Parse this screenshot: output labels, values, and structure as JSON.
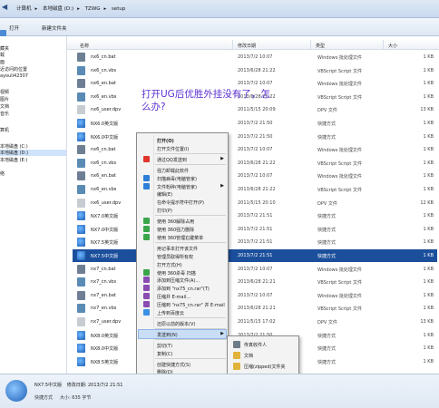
{
  "address": {
    "parts": [
      "计算机",
      "本地磁盘 (D:)",
      "TZWG",
      "setup"
    ]
  },
  "toolbar": {
    "open": "打开",
    "new_folder": "新建文件夹"
  },
  "nav": {
    "items": [
      {
        "label": "藏夹",
        "selected": false
      },
      {
        "label": "载",
        "selected": false
      },
      {
        "label": "面",
        "selected": false
      },
      {
        "label": "近访问的位置",
        "selected": false
      },
      {
        "label": "ayouli42307",
        "selected": false
      },
      {
        "label": "视频",
        "selected": false
      },
      {
        "label": "图片",
        "selected": false
      },
      {
        "label": "文档",
        "selected": false
      },
      {
        "label": "音乐",
        "selected": false
      },
      {
        "label": "算机",
        "selected": false
      },
      {
        "label": "本地磁盘 (C:)",
        "selected": false
      },
      {
        "label": "本地磁盘 (D:)",
        "selected": true
      },
      {
        "label": "本地磁盘 (E:)",
        "selected": false
      },
      {
        "label": "络",
        "selected": false
      }
    ]
  },
  "headers": {
    "name": "名称",
    "date": "修改日期",
    "type": "类型",
    "size": "大小"
  },
  "files": [
    {
      "name": "nx6_cn.bat",
      "date": "2013/7/2 10:07",
      "type": "Windows 批处理文件",
      "size": "1 KB",
      "icon": "bat",
      "selected": false
    },
    {
      "name": "nx6_cn.vbs",
      "date": "2013/6/28 21:22",
      "type": "VBScript Script 文件",
      "size": "1 KB",
      "icon": "vbs",
      "selected": false
    },
    {
      "name": "nx6_en.bat",
      "date": "2013/7/2 10:07",
      "type": "Windows 批处理文件",
      "size": "1 KB",
      "icon": "bat",
      "selected": false
    },
    {
      "name": "nx6_en.vbs",
      "date": "2013/6/28 21:22",
      "type": "VBScript Script 文件",
      "size": "1 KB",
      "icon": "vbs",
      "selected": false
    },
    {
      "name": "nx6_user.dpv",
      "date": "2011/5/15 20:09",
      "type": "DPV 文件",
      "size": "13 KB",
      "icon": "dpv",
      "selected": false
    },
    {
      "name": "NX6.0英文版",
      "date": "2013/7/2 21:50",
      "type": "快捷方式",
      "size": "1 KB",
      "icon": "lnk",
      "selected": false
    },
    {
      "name": "NX6.0中文版",
      "date": "2013/7/2 21:50",
      "type": "快捷方式",
      "size": "1 KB",
      "icon": "lnk",
      "selected": false
    },
    {
      "name": "nx6_cn.bat",
      "date": "2013/7/2 10:07",
      "type": "Windows 批处理文件",
      "size": "1 KB",
      "icon": "bat",
      "selected": false
    },
    {
      "name": "nx6_cn.vbs",
      "date": "2013/6/28 21:22",
      "type": "VBScript Script 文件",
      "size": "1 KB",
      "icon": "vbs",
      "selected": false
    },
    {
      "name": "nx6_en.bat",
      "date": "2013/7/2 10:07",
      "type": "Windows 批处理文件",
      "size": "1 KB",
      "icon": "bat",
      "selected": false
    },
    {
      "name": "nx6_en.vbs",
      "date": "2013/6/28 21:22",
      "type": "VBScript Script 文件",
      "size": "1 KB",
      "icon": "vbs",
      "selected": false
    },
    {
      "name": "nx6_user.dpv",
      "date": "2011/5/15 20:10",
      "type": "DPV 文件",
      "size": "12 KB",
      "icon": "dpv",
      "selected": false
    },
    {
      "name": "NX7.0英文版",
      "date": "2013/7/2 21:51",
      "type": "快捷方式",
      "size": "1 KB",
      "icon": "lnk",
      "selected": false
    },
    {
      "name": "NX7.0中文版",
      "date": "2013/7/2 21:51",
      "type": "快捷方式",
      "size": "1 KB",
      "icon": "lnk",
      "selected": false
    },
    {
      "name": "NX7.5英文版",
      "date": "2013/7/2 21:51",
      "type": "快捷方式",
      "size": "1 KB",
      "icon": "lnk",
      "selected": false
    },
    {
      "name": "NX7.5中文版",
      "date": "2013/7/2 21:51",
      "type": "快捷方式",
      "size": "1 KB",
      "icon": "lnk",
      "selected": true
    },
    {
      "name": "nx7_cn.bat",
      "date": "2013/7/2 10:07",
      "type": "Windows 批处理文件",
      "size": "1 KB",
      "icon": "bat",
      "selected": false
    },
    {
      "name": "nx7_cn.vbs",
      "date": "2013/6/28 21:21",
      "type": "VBScript Script 文件",
      "size": "1 KB",
      "icon": "vbs",
      "selected": false
    },
    {
      "name": "nx7_en.bat",
      "date": "2013/7/2 10:07",
      "type": "Windows 批处理文件",
      "size": "1 KB",
      "icon": "bat",
      "selected": false
    },
    {
      "name": "nx7_en.vbs",
      "date": "2013/6/28 21:21",
      "type": "VBScript Script 文件",
      "size": "1 KB",
      "icon": "vbs",
      "selected": false
    },
    {
      "name": "nx7_user.dpv",
      "date": "2011/5/15 17:02",
      "type": "DPV 文件",
      "size": "13 KB",
      "icon": "dpv",
      "selected": false
    },
    {
      "name": "NX8.0英文版",
      "date": "2013/7/2 21:50",
      "type": "快捷方式",
      "size": "1 KB",
      "icon": "lnk",
      "selected": false
    },
    {
      "name": "NX8.0中文版",
      "date": "2013/7/2 21:50",
      "type": "快捷方式",
      "size": "1 KB",
      "icon": "lnk",
      "selected": false
    },
    {
      "name": "NX8.5英文版",
      "date": "2013/7/2 21:51",
      "type": "快捷方式",
      "size": "1 KB",
      "icon": "lnk",
      "selected": false
    }
  ],
  "overlay_text": "打开UG后优胜外挂没有了，怎么办?",
  "context_menu": {
    "items": [
      {
        "label": "打开(O)",
        "bold": true,
        "arrow": false,
        "icon": ""
      },
      {
        "label": "打开文件位置(I)",
        "bold": false,
        "arrow": false,
        "icon": ""
      },
      {
        "sep": true
      },
      {
        "label": "通过QQ发送到",
        "bold": false,
        "arrow": true,
        "icon": "qq"
      },
      {
        "sep": true
      },
      {
        "label": "强力卸载此软件",
        "bold": false,
        "arrow": false,
        "icon": ""
      },
      {
        "label": "扫描病毒(电脑管家)",
        "bold": false,
        "arrow": false,
        "icon": "shield"
      },
      {
        "label": "文件粉碎(电脑管家)",
        "bold": false,
        "arrow": true,
        "icon": "shield"
      },
      {
        "label": "编辑(E)",
        "bold": false,
        "arrow": false,
        "icon": ""
      },
      {
        "label": "在命令提示符中打开(P)",
        "bold": false,
        "arrow": false,
        "icon": ""
      },
      {
        "label": "打印(P)",
        "bold": false,
        "arrow": false,
        "icon": ""
      },
      {
        "sep": true
      },
      {
        "label": "使用 360解除占用",
        "bold": false,
        "arrow": false,
        "icon": "360"
      },
      {
        "label": "使用 360强力删除",
        "bold": false,
        "arrow": false,
        "icon": "360"
      },
      {
        "label": "使用 360管理右键菜单",
        "bold": false,
        "arrow": false,
        "icon": "360"
      },
      {
        "sep": true
      },
      {
        "label": "用记事本打开该文件",
        "bold": false,
        "arrow": false,
        "icon": ""
      },
      {
        "label": "管理员取得所有权",
        "bold": false,
        "arrow": false,
        "icon": ""
      },
      {
        "label": "打开方式(H)",
        "bold": false,
        "arrow": false,
        "icon": ""
      },
      {
        "label": "使用 360杀毒 扫描",
        "bold": false,
        "arrow": false,
        "icon": "360"
      },
      {
        "label": "添加到压缩文件(A)...",
        "bold": false,
        "arrow": false,
        "icon": "rar"
      },
      {
        "label": "添加到 \"nx75_cn.rar\"(T)",
        "bold": false,
        "arrow": false,
        "icon": "rar"
      },
      {
        "label": "压缩并 E-mail...",
        "bold": false,
        "arrow": false,
        "icon": "rar"
      },
      {
        "label": "压缩到 \"nx75_cn.rar\" 并 E-mail",
        "bold": false,
        "arrow": false,
        "icon": "rar"
      },
      {
        "label": "上传到百度云",
        "bold": false,
        "arrow": false,
        "icon": "cloud"
      },
      {
        "sep": true
      },
      {
        "label": "还原以前的版本(V)",
        "bold": false,
        "arrow": false,
        "icon": ""
      },
      {
        "sep": true
      },
      {
        "label": "发送到(N)",
        "bold": false,
        "arrow": true,
        "icon": "",
        "highlight": true
      },
      {
        "sep": true
      },
      {
        "label": "剪切(T)",
        "bold": false,
        "arrow": false,
        "icon": ""
      },
      {
        "label": "复制(C)",
        "bold": false,
        "arrow": false,
        "icon": ""
      },
      {
        "sep": true
      },
      {
        "label": "创建快捷方式(S)",
        "bold": false,
        "arrow": false,
        "icon": ""
      },
      {
        "label": "删除(D)",
        "bold": false,
        "arrow": false,
        "icon": ""
      },
      {
        "label": "重命名(M)",
        "bold": false,
        "arrow": false,
        "icon": ""
      },
      {
        "sep": true
      },
      {
        "label": "属性(R)",
        "bold": false,
        "arrow": false,
        "icon": ""
      }
    ]
  },
  "submenu": {
    "items": [
      {
        "label": "传真收件人",
        "icon": "fax",
        "highlight": false
      },
      {
        "label": "文档",
        "icon": "doc",
        "highlight": false
      },
      {
        "label": "压缩(zipped)文件夹",
        "icon": "zip",
        "highlight": false
      },
      {
        "label": "邮件收件人",
        "icon": "mail",
        "highlight": false
      },
      {
        "label": "桌面快捷方式",
        "icon": "desktop",
        "highlight": true
      }
    ]
  },
  "details": {
    "name": "NX7.5中文版",
    "date_label": "修改日期: 2013/7/2 21:51",
    "type": "快捷方式",
    "size_label": "大小: 635 字节"
  },
  "colors": {
    "selection": "#1b4f9c",
    "overlay_text": "#5a2fd0",
    "menu_highlight": "#c9def5"
  }
}
